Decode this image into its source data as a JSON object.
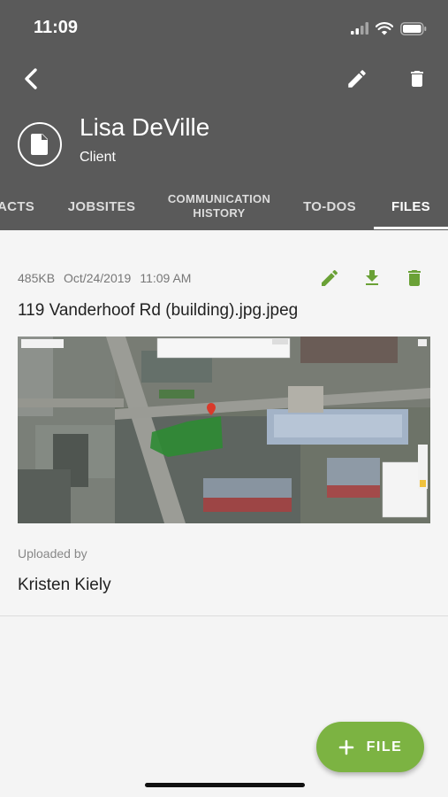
{
  "status_bar": {
    "time": "11:09",
    "icons": [
      "signal-icon",
      "wifi-icon",
      "battery-icon"
    ]
  },
  "toolbar": {
    "back_icon": "chevron-left-icon",
    "edit_icon": "pencil-icon",
    "delete_icon": "trash-icon"
  },
  "contact": {
    "name": "Lisa DeVille",
    "role": "Client",
    "avatar_icon": "document-icon"
  },
  "tabs": [
    {
      "label": "ACTS",
      "active": false
    },
    {
      "label": "JOBSITES",
      "active": false
    },
    {
      "label_line1": "COMMUNICATION",
      "label_line2": "HISTORY",
      "active": false
    },
    {
      "label": "TO-DOS",
      "active": false
    },
    {
      "label": "FILES",
      "active": true
    }
  ],
  "file": {
    "size": "485KB",
    "date": "Oct/24/2019",
    "time": "11:09 AM",
    "name": "119 Vanderhoof Rd (building).jpg.jpeg",
    "uploaded_by_label": "Uploaded by",
    "uploaded_by": "Kristen Kiely",
    "actions": [
      "pencil-icon",
      "download-icon",
      "trash-icon"
    ]
  },
  "fab": {
    "label": "FILE",
    "icon": "plus-icon"
  },
  "colors": {
    "header_bg": "#5a5a5a",
    "accent_green": "#7cb342",
    "action_green": "#6aa136",
    "page_bg": "#f4f4f4"
  }
}
